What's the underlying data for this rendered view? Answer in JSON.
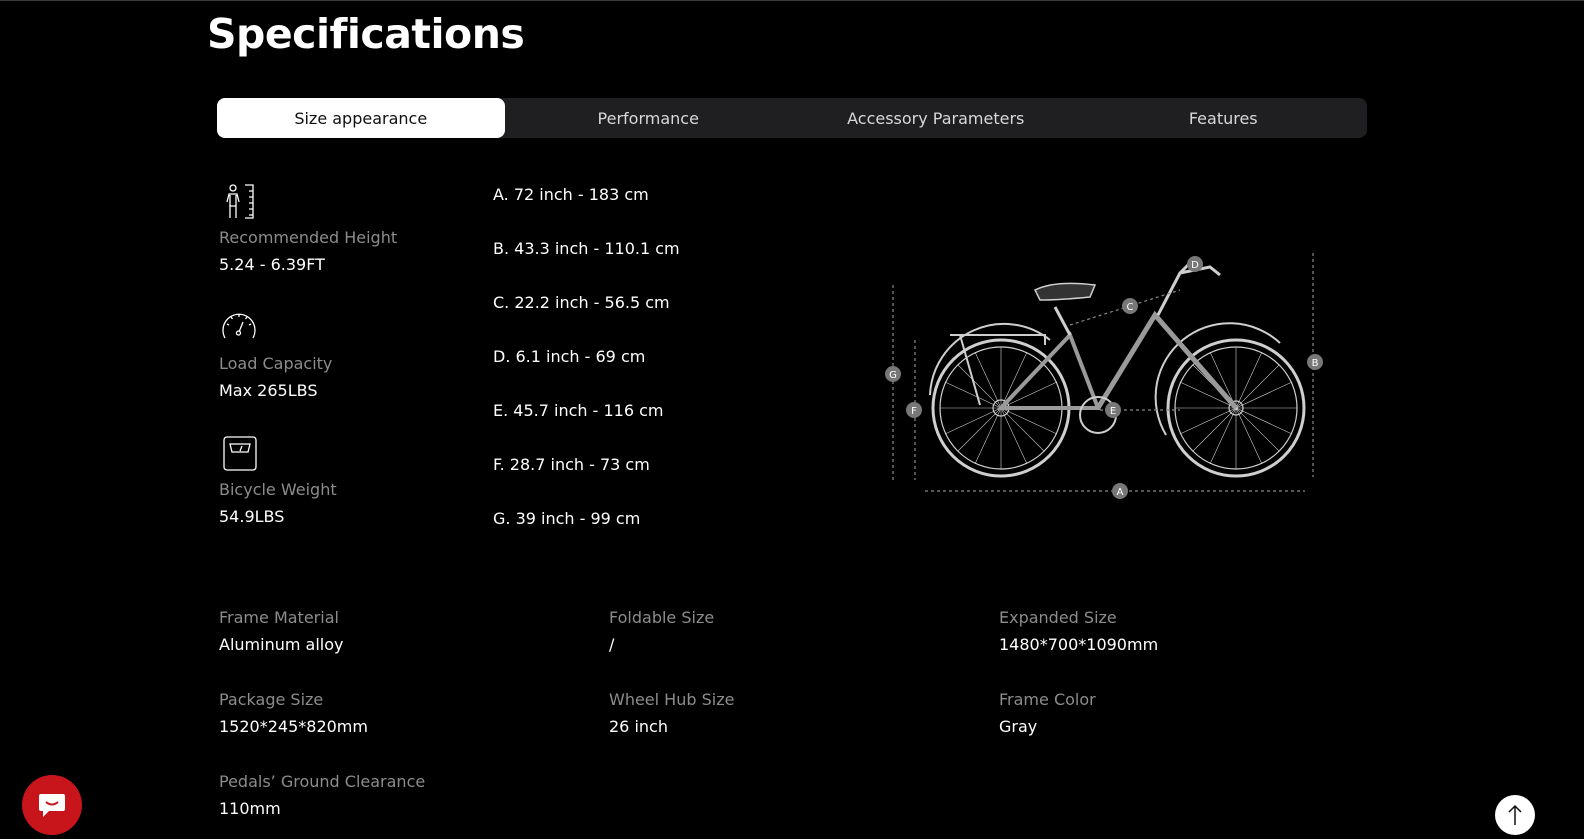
{
  "page": {
    "title": "Specifications"
  },
  "tabs": [
    {
      "label": "Size appearance",
      "active": true
    },
    {
      "label": "Performance",
      "active": false
    },
    {
      "label": "Accessory Parameters",
      "active": false
    },
    {
      "label": "Features",
      "active": false
    }
  ],
  "left_specs": [
    {
      "icon": "person-height-icon",
      "label": "Recommended Height",
      "value": "5.24 - 6.39FT"
    },
    {
      "icon": "speedometer-icon",
      "label": "Load Capacity",
      "value": "Max 265LBS"
    },
    {
      "icon": "scale-icon",
      "label": "Bicycle Weight",
      "value": "54.9LBS"
    }
  ],
  "dimensions": [
    "A. 72 inch - 183 cm",
    "B. 43.3 inch - 110.1 cm",
    "C. 22.2 inch - 56.5 cm",
    "D. 6.1 inch - 69 cm",
    "E. 45.7 inch - 116 cm",
    "F. 28.7 inch - 73 cm",
    "G. 39 inch - 99 cm"
  ],
  "diagram_markers": [
    "A",
    "B",
    "C",
    "D",
    "E",
    "F",
    "G"
  ],
  "spec_grid": [
    {
      "label": "Frame Material",
      "value": "Aluminum alloy"
    },
    {
      "label": "Foldable Size",
      "value": "/"
    },
    {
      "label": "Expanded Size",
      "value": "1480*700*1090mm"
    },
    {
      "label": "Package Size",
      "value": "1520*245*820mm"
    },
    {
      "label": "Wheel Hub Size",
      "value": "26 inch"
    },
    {
      "label": "Frame Color",
      "value": "Gray"
    },
    {
      "label": "Pedals’ Ground Clearance",
      "value": "110mm"
    }
  ],
  "floating": {
    "chat_icon": "chat-bubble-icon",
    "scroll_top_icon": "arrow-up-icon"
  },
  "colors": {
    "background": "#000000",
    "tab_bar": "#1f1f21",
    "muted_text": "#8c8c8c",
    "chat_button": "#c8151b"
  }
}
